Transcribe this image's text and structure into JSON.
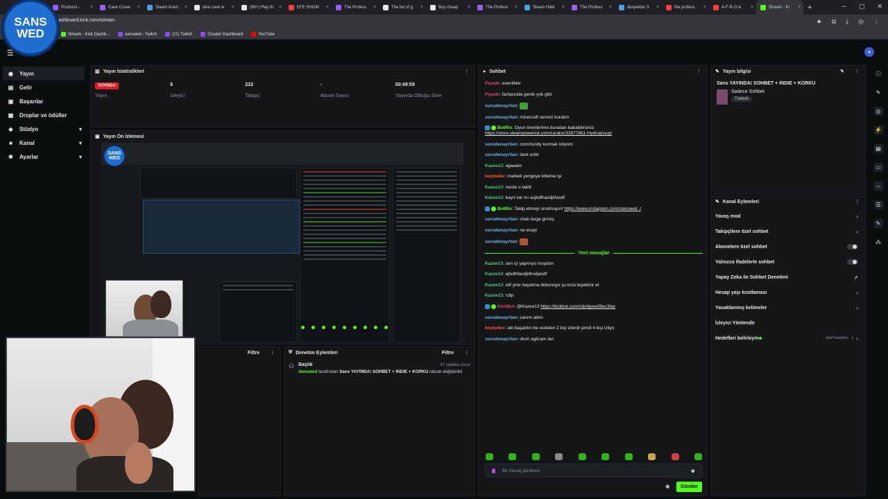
{
  "browser": {
    "tabs": [
      {
        "label": "Products - ",
        "color": "#9b59ff"
      },
      {
        "label": "Cave Crave",
        "color": "#9b59ff"
      },
      {
        "label": "Steam Aram",
        "color": "#4aa3df"
      },
      {
        "label": "dive cave w",
        "color": "#e6e8ea"
      },
      {
        "label": "(99+) Play th",
        "color": "#e6e8ea"
      },
      {
        "label": "EFE SHOW",
        "color": "#ff3b3b"
      },
      {
        "label": "The Profess",
        "color": "#9b59ff"
      },
      {
        "label": "The list of g",
        "color": "#e6e8ea"
      },
      {
        "label": "Buy cheap ",
        "color": "#e6e8ea"
      },
      {
        "label": "The Profess",
        "color": "#9b59ff"
      },
      {
        "label": "Steam Habi",
        "color": "#4aa3df"
      },
      {
        "label": "The Profess",
        "color": "#9b59ff"
      },
      {
        "label": "despelote S",
        "color": "#4aa3df"
      },
      {
        "label": "the profess",
        "color": "#ff3b3b"
      },
      {
        "label": "A-F-R-O & ",
        "color": "#ff3b3b"
      },
      {
        "label": "Stream - Ki",
        "color": "#53fc18"
      }
    ],
    "url": "dashboard.kick.com/stream",
    "bookmarks": [
      {
        "label": "Stream - Kick Dashb...",
        "color": "#53fc18"
      },
      {
        "label": "sanswed - Twitch",
        "color": "#9146ff"
      },
      {
        "label": "(21) Twitch",
        "color": "#9146ff"
      },
      {
        "label": "Creator Dashboard",
        "color": "#9146ff"
      },
      {
        "label": "YouTube",
        "color": "#ff0000"
      }
    ]
  },
  "overlay": {
    "logo_line1": "SANS",
    "logo_line2": "WED"
  },
  "sidebar": {
    "items": [
      {
        "label": "Yayın",
        "icon": "broadcast-icon",
        "glyph": "◉",
        "chev": ""
      },
      {
        "label": "Gelir",
        "icon": "wallet-icon",
        "glyph": "▤",
        "chev": ""
      },
      {
        "label": "Başarılar",
        "icon": "trophy-icon",
        "glyph": "▣",
        "chev": ""
      },
      {
        "label": "Droplar ve ödüller",
        "icon": "gift-icon",
        "glyph": "▦",
        "chev": ""
      },
      {
        "label": "Stüdyo",
        "icon": "studio-icon",
        "glyph": "◆",
        "chev": "▾"
      },
      {
        "label": "Kanal",
        "icon": "channel-icon",
        "glyph": "■",
        "chev": "▾"
      },
      {
        "label": "Ayarlar",
        "icon": "gear-icon",
        "glyph": "✱",
        "chev": "▾"
      }
    ]
  },
  "stats_panel": {
    "title": "Yayın İstatistikleri",
    "live_badge": "YAYINDA",
    "stats": [
      {
        "value": "",
        "label": "Yayın"
      },
      {
        "value": "6",
        "label": "İzleyici"
      },
      {
        "value": "222",
        "label": "Takipçi"
      },
      {
        "value": "-",
        "label": "Abone Sayısı"
      },
      {
        "value": "00:49:59",
        "label": "Yayında Olduğu Süre"
      }
    ]
  },
  "preview_panel": {
    "title": "Yayın Ön İzlemesi"
  },
  "filter_panel": {
    "filter_label": "Filtre"
  },
  "moderation_panel": {
    "title": "Denetim Eylemleri",
    "filter_label": "Filtre",
    "entry_title": "Başlık",
    "entry_time": "47 dakika önce",
    "entry_user": "Sanswed",
    "entry_pre": " tarafından ",
    "entry_value": "Sans YAYINDA! SOHBET + INDIE + KORKU",
    "entry_post": " olarak değiştirildi"
  },
  "chat_panel": {
    "title": "Sohbet",
    "messages": [
      {
        "user": "Piyade",
        "color": "#e0436b",
        "text": ": esenlikler"
      },
      {
        "user": "Piyade",
        "color": "#e0436b",
        "text": ": fazlasında gerek yok gibi"
      },
      {
        "user": "surudenayrilan",
        "color": "#6cb4e8",
        "text": ":",
        "emote": "#3aa336"
      },
      {
        "user": "surudenayrilan",
        "color": "#6cb4e8",
        "text": ": minecraft serveri kuralım"
      },
      {
        "user": "BotRix",
        "color": "#53fc18",
        "bot": true,
        "text": ": Oyun önerilerime buradan bakabilirsiniz:",
        "link": "https://store.steampowered.com/curator/32877881-Hydrogroup/"
      },
      {
        "user": "surudenayrilan",
        "color": "#6cb4e8",
        "text": ": community kurmak istiyom"
      },
      {
        "user": "surudenayrilan",
        "color": "#6cb4e8",
        "text": ": dark orbit"
      },
      {
        "user": "Kazee13",
        "color": "#53c878",
        "text": ": agaaam"
      },
      {
        "user": "beytodev",
        "color": "#ff5a3c",
        "text": ": marketi yengeye kitleme işi"
      },
      {
        "user": "Kazee13",
        "color": "#53c878",
        "text": ": nerde o taklit"
      },
      {
        "user": "Kazee13",
        "color": "#53c878",
        "text": ": kayıt var mı asjkdfhasdjkfasdf"
      },
      {
        "user": "BotRix",
        "color": "#53fc18",
        "bot": true,
        "text": ": Takip etmeyi unutmayın! ",
        "link": "https://www.instagram.com/sanswed_/"
      },
      {
        "user": "surudenayrilan",
        "color": "#6cb4e8",
        "text": ": chatı buga girmiş"
      },
      {
        "user": "surudenayrilan",
        "color": "#6cb4e8",
        "text": ": ne enayi"
      },
      {
        "user": "surudenayrilan",
        "color": "#6cb4e8",
        "text": ":",
        "emote": "#b0553a"
      }
    ],
    "divider": "Yeni mesajlar",
    "messages2": [
      {
        "user": "Kazee13",
        "color": "#53c878",
        "text": ": sen rp yapmıyo muydun"
      },
      {
        "user": "Kazee13",
        "color": "#53c878",
        "text": ": ajlsdhfasdjklhsdjasdf"
      },
      {
        "user": "Kazee13",
        "color": "#53c878",
        "text": ": elif yine hayatına dokunuyo şu kıza teşekkür et"
      },
      {
        "user": "Kazee13",
        "color": "#53c878",
        "text": ": !clip"
      },
      {
        "user": "KickBot",
        "color": "#e0436b",
        "bot": true,
        "text": ": @Kazee13 ",
        "link": "https://kickbot.com/clip/igww39ec3lxp"
      },
      {
        "user": "surudenayrilan",
        "color": "#6cb4e8",
        "text": ": canım abim"
      },
      {
        "user": "beytodev",
        "color": "#ff5a3c",
        "text": ": abi başardın be eskiden 2 kişi izlerdi şimdi 4 kişi izliyo"
      },
      {
        "user": "surudenayrilan",
        "color": "#6cb4e8",
        "text": ": olum aglicam lan"
      }
    ],
    "input_placeholder": "Bir mesaj gönderin",
    "send_label": "Gönder"
  },
  "stream_info": {
    "title": "Yayın bilgisi",
    "stream_title": "Sans YAYINDA! SOHBET + INDIE + KORKU",
    "category": "Sadece Sohbet",
    "language": "Türkish"
  },
  "channel_actions": {
    "title": "Kanal Eylemleri",
    "items": [
      {
        "label": "Yavaş mod",
        "control": "chevron"
      },
      {
        "label": "Takipçilere özel sohbet",
        "control": "chevron"
      },
      {
        "label": "Abonelere özel sohbet",
        "control": "toggle"
      },
      {
        "label": "Yalnızca ifadelerle sohbet",
        "control": "toggle"
      },
      {
        "label": "Yapay Zeka ile Sohbet Denetimi",
        "control": "external"
      },
      {
        "label": "Hesap yaşı kısıtlaması",
        "control": "chevron"
      },
      {
        "label": "Yasaklanmış kelimeler",
        "control": "chevron"
      },
      {
        "label": "İzleyici Yönlendir",
        "control": "none"
      },
      {
        "label": "Hedefleri belirleyin",
        "control": "chevron",
        "extra": "Aktif hedefler - 1"
      }
    ]
  }
}
